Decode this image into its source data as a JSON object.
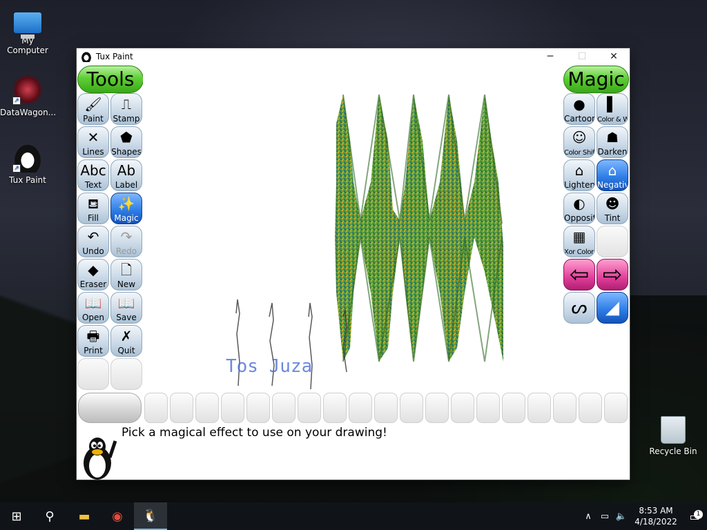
{
  "desktop": {
    "icons": [
      {
        "label": "My Computer",
        "icon": "computer-icon"
      },
      {
        "label": "DataWagon...",
        "icon": "datawagon-icon"
      },
      {
        "label": "Tux Paint",
        "icon": "tux-paint-icon"
      },
      {
        "label": "Recycle Bin",
        "icon": "recycle-bin-icon"
      }
    ]
  },
  "window": {
    "title": "Tux Paint",
    "controls": {
      "minimize": "─",
      "maximize": "☐",
      "close": "✕"
    }
  },
  "tools": {
    "header": "Tools",
    "items": [
      {
        "label": "Paint",
        "glyph": "🖌"
      },
      {
        "label": "Stamp",
        "glyph": "⎍"
      },
      {
        "label": "Lines",
        "glyph": "✕"
      },
      {
        "label": "Shapes",
        "glyph": "⬟"
      },
      {
        "label": "Text",
        "glyph": "Abc"
      },
      {
        "label": "Label",
        "glyph": "Ab"
      },
      {
        "label": "Fill",
        "glyph": "⛾"
      },
      {
        "label": "Magic",
        "glyph": "✨",
        "selected": true
      },
      {
        "label": "Undo",
        "glyph": "↶"
      },
      {
        "label": "Redo",
        "glyph": "↷",
        "disabled": true
      },
      {
        "label": "Eraser",
        "glyph": "◆"
      },
      {
        "label": "New",
        "glyph": "🗋"
      },
      {
        "label": "Open",
        "glyph": "📖"
      },
      {
        "label": "Save",
        "glyph": "📖"
      },
      {
        "label": "Print",
        "glyph": "🖶"
      },
      {
        "label": "Quit",
        "glyph": "✗"
      }
    ]
  },
  "magic": {
    "header": "Magic",
    "items": [
      {
        "label": "Cartoon",
        "glyph": "●"
      },
      {
        "label": "Color & White",
        "glyph": "▌"
      },
      {
        "label": "Color Shift",
        "glyph": "☺"
      },
      {
        "label": "Darken",
        "glyph": "☗"
      },
      {
        "label": "Lighten",
        "glyph": "⌂"
      },
      {
        "label": "Negative",
        "glyph": "⌂",
        "selected": true
      },
      {
        "label": "Opposite",
        "glyph": "◐"
      },
      {
        "label": "Tint",
        "glyph": "☻"
      },
      {
        "label": "Xor Colors",
        "glyph": "▦"
      }
    ],
    "nav": {
      "prev": "⇦",
      "next": "⇨"
    },
    "modes": [
      {
        "name": "paint-mode",
        "glyph": "ᔕ"
      },
      {
        "name": "fullscreen-mode",
        "glyph": "◢"
      }
    ]
  },
  "canvas": {
    "text_drawing": "Tos Juza"
  },
  "status": {
    "message": "Pick a magical effect to use on your drawing!"
  },
  "taskbar": {
    "clock_time": "8:53 AM",
    "clock_date": "4/18/2022",
    "notification_count": "1",
    "apps": [
      {
        "name": "start",
        "glyph": "⊞"
      },
      {
        "name": "search",
        "glyph": "⚲"
      },
      {
        "name": "file-explorer",
        "glyph": "▬"
      },
      {
        "name": "chrome",
        "glyph": "◉"
      },
      {
        "name": "tux-paint",
        "glyph": "🐧"
      }
    ]
  },
  "colors": {
    "pill_green": "#5fcf36",
    "selected_blue": "#2f7fe8",
    "nav_pink": "#e0409a",
    "zigzag_green": "#3f8f2a",
    "zigzag_yellow": "#c9a02a",
    "text_blue": "#4a6cd4"
  }
}
